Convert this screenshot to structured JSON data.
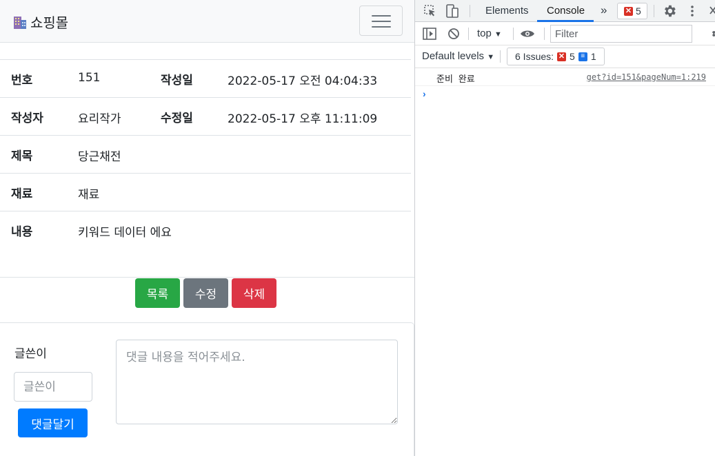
{
  "navbar": {
    "brand": "쇼핑몰"
  },
  "detail": {
    "rows": [
      {
        "k1": "번호",
        "v1": "151",
        "k2": "작성일",
        "v2": "2022-05-17 오전 04:04:33"
      },
      {
        "k1": "작성자",
        "v1": "요리작가",
        "k2": "수정일",
        "v2": "2022-05-17 오후 11:11:09"
      },
      {
        "k1": "제목",
        "v1": "당근채전"
      },
      {
        "k1": "재료",
        "v1": "재료"
      },
      {
        "k1": "내용",
        "v1": "키워드 데이터 에요"
      }
    ]
  },
  "buttons": {
    "list": "목록",
    "edit": "수정",
    "delete": "삭제"
  },
  "comment": {
    "writer_label": "글쓴이",
    "writer_placeholder": "글쓴이",
    "content_placeholder": "댓글 내용을 적어주세요.",
    "submit": "댓글달기"
  },
  "devtools": {
    "tabs": {
      "elements": "Elements",
      "console": "Console"
    },
    "error_count": "5",
    "context": "top",
    "filter_placeholder": "Filter",
    "levels": "Default levels",
    "issues_label": "6 Issues:",
    "issues_errors": "5",
    "issues_info": "1",
    "log_message": "준비 완료",
    "log_source": "get?id=151&pageNum=1:219",
    "colors": {
      "accent": "#1a73e8",
      "error": "#d93025"
    }
  },
  "colors": {
    "success": "#28a745",
    "secondary": "#6c757d",
    "danger": "#dc3545",
    "primary": "#007bff"
  }
}
